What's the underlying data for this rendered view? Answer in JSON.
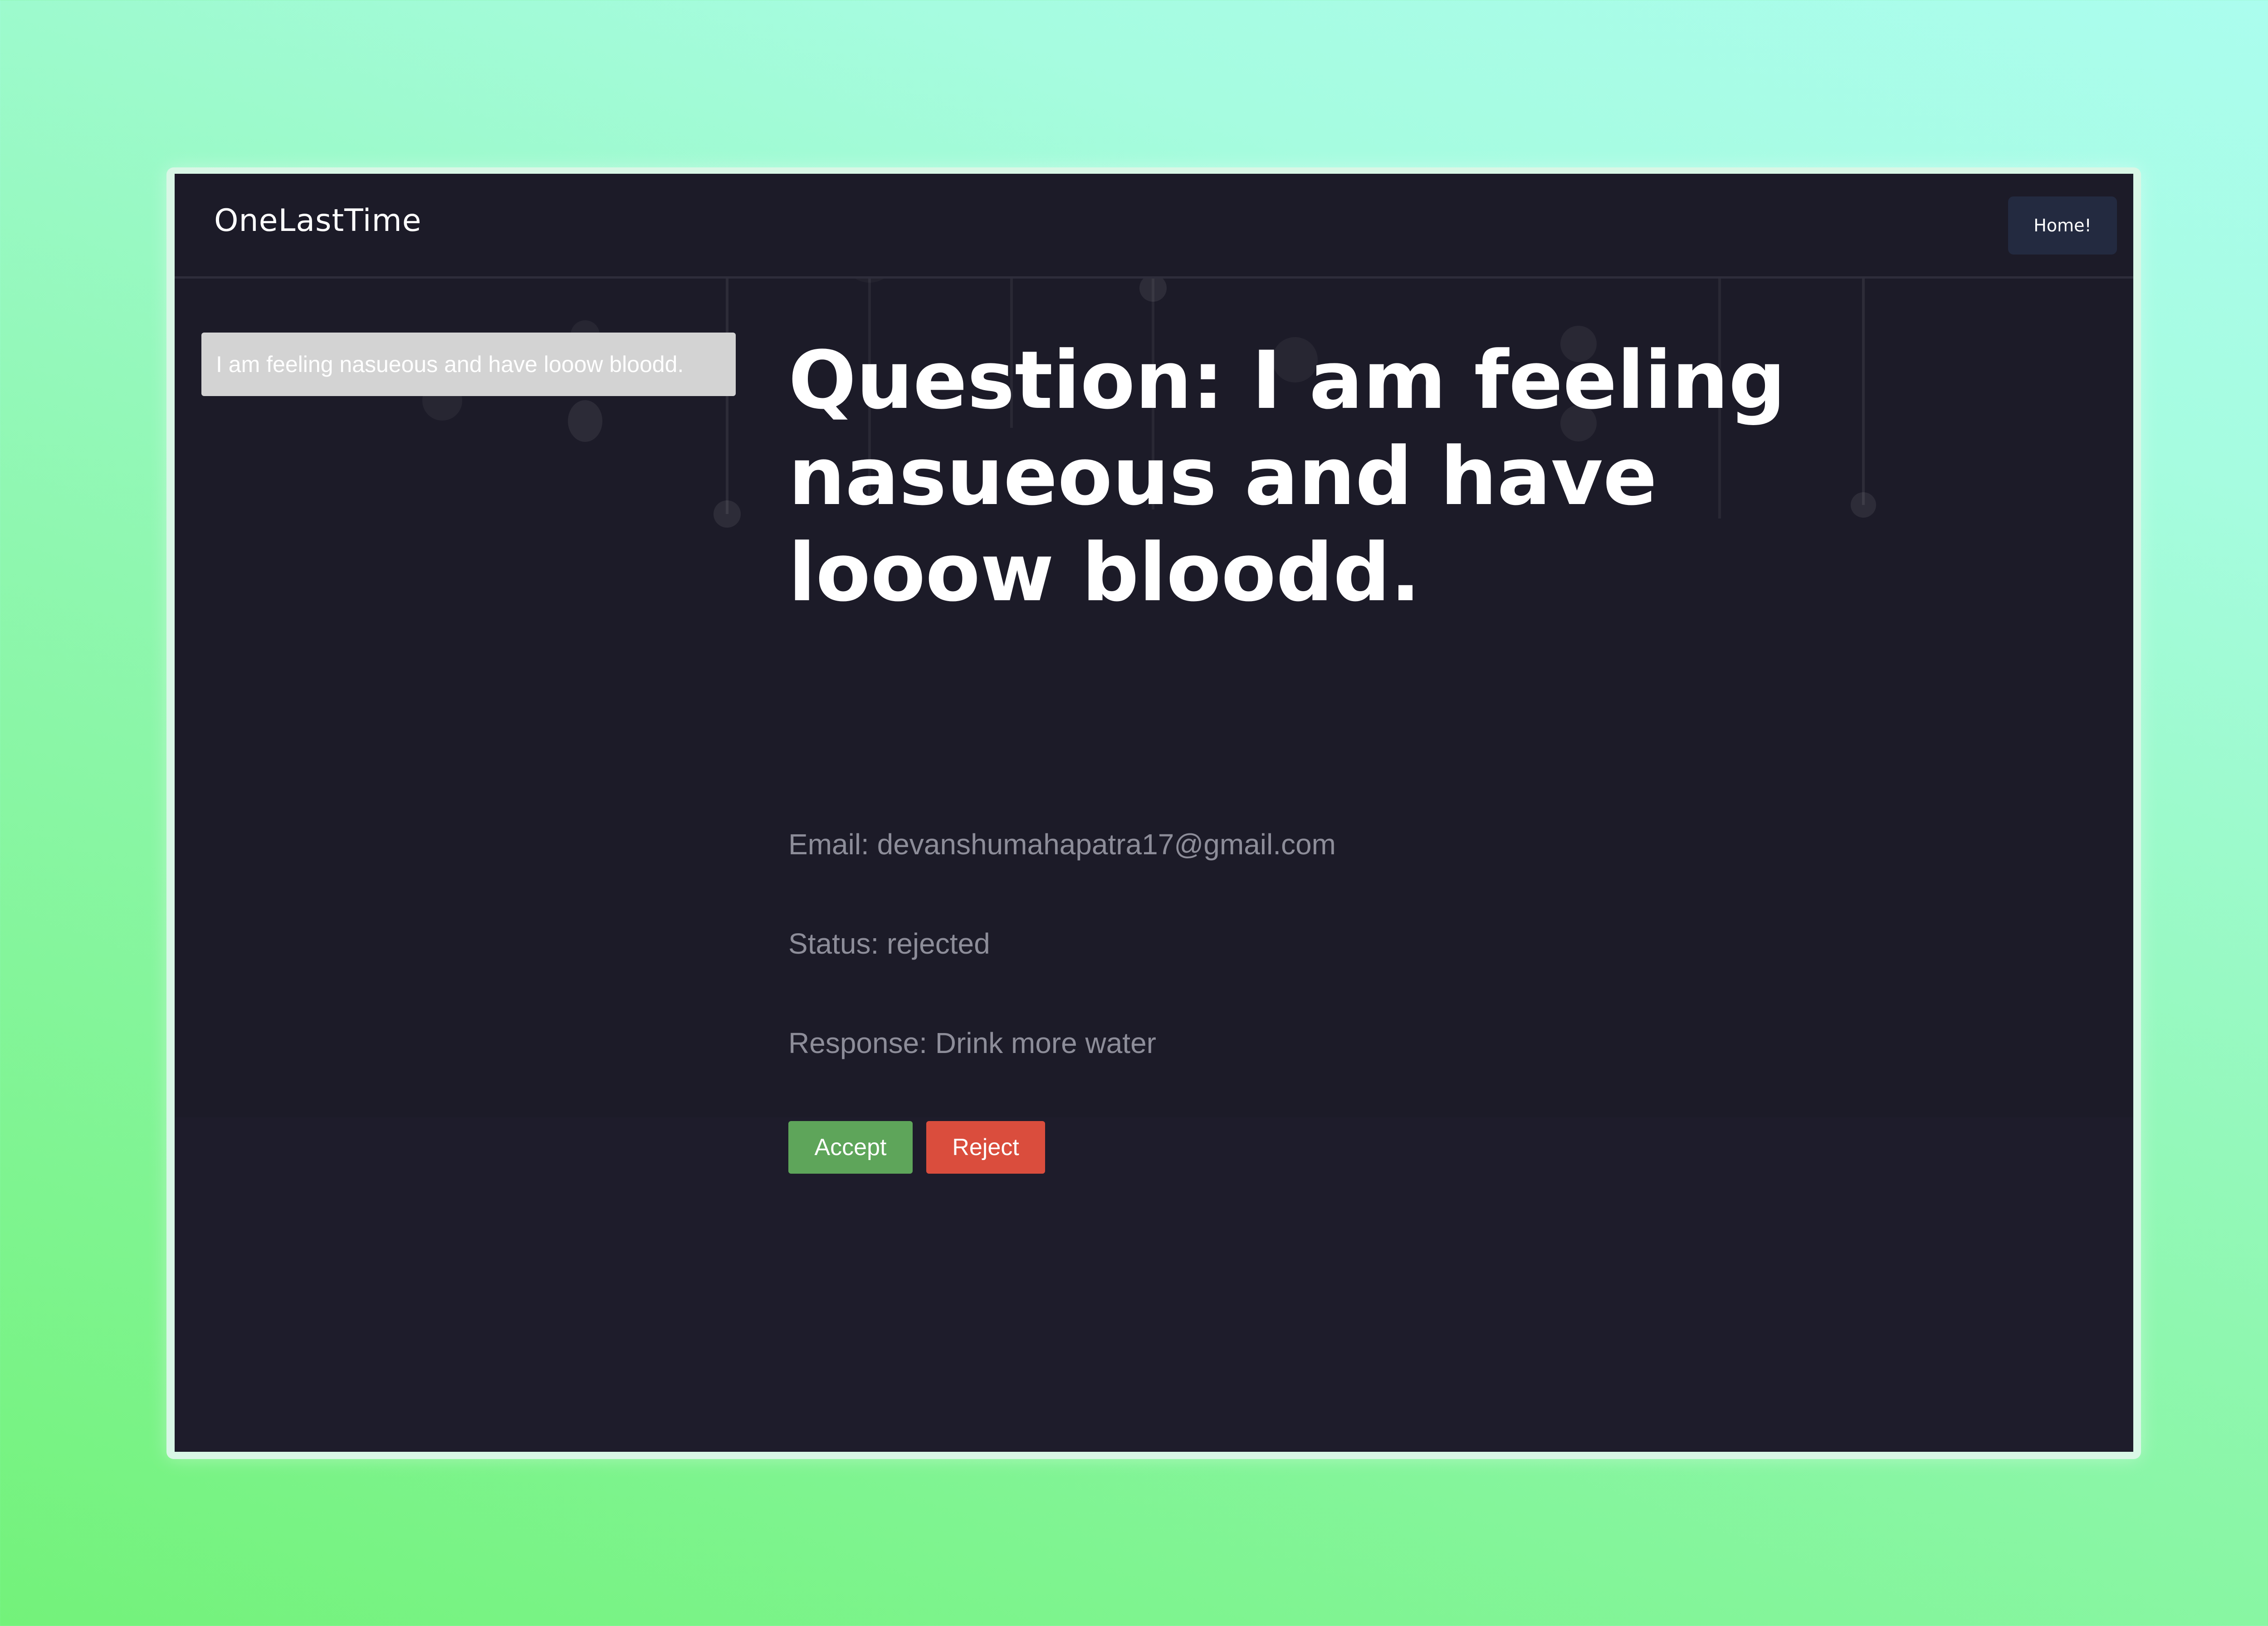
{
  "app": {
    "brand": "OneLastTime",
    "home_label": "Home!"
  },
  "sidebar": {
    "items": [
      {
        "label": "I am feeling nasueous and have looow bloodd."
      }
    ]
  },
  "question": {
    "title": "Question: I am feeling nasueous and have looow bloodd.",
    "email": "Email: devanshumahapatra17@gmail.com",
    "status": "Status: rejected",
    "response": "Response: Drink more water"
  },
  "actions": {
    "accept_label": "Accept",
    "reject_label": "Reject"
  },
  "colors": {
    "window_bg": "#1c1b28",
    "accept": "#5ea55a",
    "reject": "#da4d3d",
    "sidebar_item_bg": "#d3d3d3",
    "home_button_bg": "#232a40",
    "meta_text": "#8d8d99"
  }
}
